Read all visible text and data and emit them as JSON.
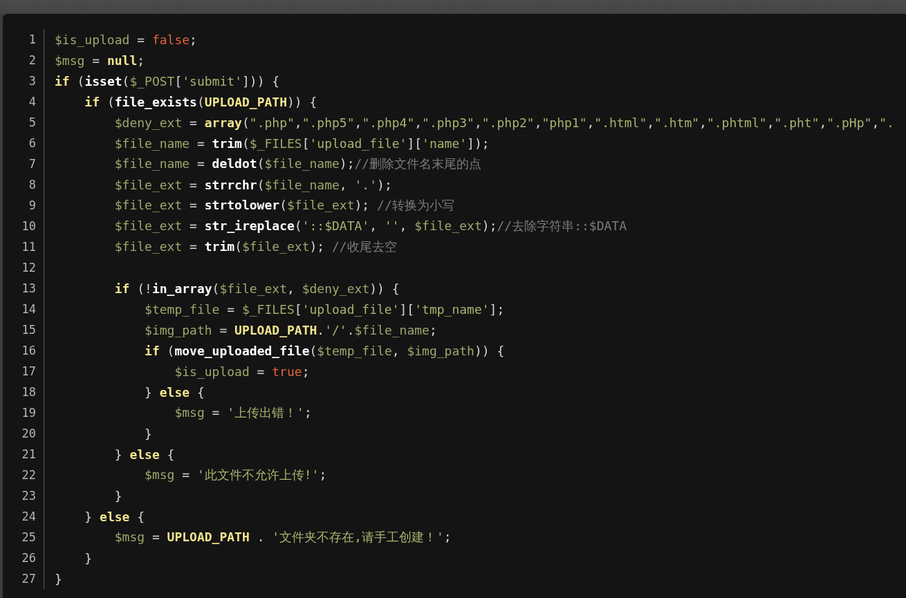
{
  "code": {
    "lines": [
      {
        "number": "1",
        "tokens": [
          {
            "kind": "var",
            "text": "$is_upload"
          },
          {
            "kind": "plain",
            "text": " = "
          },
          {
            "kind": "lit",
            "text": "false"
          },
          {
            "kind": "plain",
            "text": ";"
          }
        ]
      },
      {
        "number": "2",
        "tokens": [
          {
            "kind": "var",
            "text": "$msg"
          },
          {
            "kind": "plain",
            "text": " = "
          },
          {
            "kind": "kw",
            "text": "null"
          },
          {
            "kind": "plain",
            "text": ";"
          }
        ]
      },
      {
        "number": "3",
        "tokens": [
          {
            "kind": "kw",
            "text": "if"
          },
          {
            "kind": "plain",
            "text": " ("
          },
          {
            "kind": "fn",
            "text": "isset"
          },
          {
            "kind": "plain",
            "text": "("
          },
          {
            "kind": "var",
            "text": "$_POST"
          },
          {
            "kind": "plain",
            "text": "["
          },
          {
            "kind": "str",
            "text": "'submit'"
          },
          {
            "kind": "plain",
            "text": "])) {"
          }
        ]
      },
      {
        "number": "4",
        "tokens": [
          {
            "kind": "kw",
            "text": "    if"
          },
          {
            "kind": "plain",
            "text": " ("
          },
          {
            "kind": "fn",
            "text": "file_exists"
          },
          {
            "kind": "plain",
            "text": "("
          },
          {
            "kind": "kw",
            "text": "UPLOAD_PATH"
          },
          {
            "kind": "plain",
            "text": ")) {"
          }
        ]
      },
      {
        "number": "5",
        "tokens": [
          {
            "kind": "var",
            "text": "        $deny_ext"
          },
          {
            "kind": "plain",
            "text": " = "
          },
          {
            "kind": "kw",
            "text": "array"
          },
          {
            "kind": "plain",
            "text": "("
          },
          {
            "kind": "str",
            "text": "\".php\""
          },
          {
            "kind": "plain",
            "text": ","
          },
          {
            "kind": "str",
            "text": "\".php5\""
          },
          {
            "kind": "plain",
            "text": ","
          },
          {
            "kind": "str",
            "text": "\".php4\""
          },
          {
            "kind": "plain",
            "text": ","
          },
          {
            "kind": "str",
            "text": "\".php3\""
          },
          {
            "kind": "plain",
            "text": ","
          },
          {
            "kind": "str",
            "text": "\".php2\""
          },
          {
            "kind": "plain",
            "text": ","
          },
          {
            "kind": "str",
            "text": "\"php1\""
          },
          {
            "kind": "plain",
            "text": ","
          },
          {
            "kind": "str",
            "text": "\".html\""
          },
          {
            "kind": "plain",
            "text": ","
          },
          {
            "kind": "str",
            "text": "\".htm\""
          },
          {
            "kind": "plain",
            "text": ","
          },
          {
            "kind": "str",
            "text": "\".phtml\""
          },
          {
            "kind": "plain",
            "text": ","
          },
          {
            "kind": "str",
            "text": "\".pht\""
          },
          {
            "kind": "plain",
            "text": ","
          },
          {
            "kind": "str",
            "text": "\".pHp\""
          },
          {
            "kind": "plain",
            "text": ","
          },
          {
            "kind": "str",
            "text": "\"."
          }
        ]
      },
      {
        "number": "6",
        "tokens": [
          {
            "kind": "var",
            "text": "        $file_name"
          },
          {
            "kind": "plain",
            "text": " = "
          },
          {
            "kind": "fn",
            "text": "trim"
          },
          {
            "kind": "plain",
            "text": "("
          },
          {
            "kind": "var",
            "text": "$_FILES"
          },
          {
            "kind": "plain",
            "text": "["
          },
          {
            "kind": "str",
            "text": "'upload_file'"
          },
          {
            "kind": "plain",
            "text": "]["
          },
          {
            "kind": "str",
            "text": "'name'"
          },
          {
            "kind": "plain",
            "text": "]);"
          }
        ]
      },
      {
        "number": "7",
        "tokens": [
          {
            "kind": "var",
            "text": "        $file_name"
          },
          {
            "kind": "plain",
            "text": " = "
          },
          {
            "kind": "fn",
            "text": "deldot"
          },
          {
            "kind": "plain",
            "text": "("
          },
          {
            "kind": "var",
            "text": "$file_name"
          },
          {
            "kind": "plain",
            "text": ");"
          },
          {
            "kind": "cmt",
            "text": "//删除文件名末尾的点"
          }
        ]
      },
      {
        "number": "8",
        "tokens": [
          {
            "kind": "var",
            "text": "        $file_ext"
          },
          {
            "kind": "plain",
            "text": " = "
          },
          {
            "kind": "fn",
            "text": "strrchr"
          },
          {
            "kind": "plain",
            "text": "("
          },
          {
            "kind": "var",
            "text": "$file_name"
          },
          {
            "kind": "plain",
            "text": ", "
          },
          {
            "kind": "str",
            "text": "'.'"
          },
          {
            "kind": "plain",
            "text": ");"
          }
        ]
      },
      {
        "number": "9",
        "tokens": [
          {
            "kind": "var",
            "text": "        $file_ext"
          },
          {
            "kind": "plain",
            "text": " = "
          },
          {
            "kind": "fn",
            "text": "strtolower"
          },
          {
            "kind": "plain",
            "text": "("
          },
          {
            "kind": "var",
            "text": "$file_ext"
          },
          {
            "kind": "plain",
            "text": "); "
          },
          {
            "kind": "cmt",
            "text": "//转换为小写"
          }
        ]
      },
      {
        "number": "10",
        "tokens": [
          {
            "kind": "var",
            "text": "        $file_ext"
          },
          {
            "kind": "plain",
            "text": " = "
          },
          {
            "kind": "fn",
            "text": "str_ireplace"
          },
          {
            "kind": "plain",
            "text": "("
          },
          {
            "kind": "str",
            "text": "'::$DATA'"
          },
          {
            "kind": "plain",
            "text": ", "
          },
          {
            "kind": "str",
            "text": "''"
          },
          {
            "kind": "plain",
            "text": ", "
          },
          {
            "kind": "var",
            "text": "$file_ext"
          },
          {
            "kind": "plain",
            "text": ");"
          },
          {
            "kind": "cmt",
            "text": "//去除字符串::$DATA"
          }
        ]
      },
      {
        "number": "11",
        "tokens": [
          {
            "kind": "var",
            "text": "        $file_ext"
          },
          {
            "kind": "plain",
            "text": " = "
          },
          {
            "kind": "fn",
            "text": "trim"
          },
          {
            "kind": "plain",
            "text": "("
          },
          {
            "kind": "var",
            "text": "$file_ext"
          },
          {
            "kind": "plain",
            "text": "); "
          },
          {
            "kind": "cmt",
            "text": "//收尾去空"
          }
        ]
      },
      {
        "number": "12"
      },
      {
        "number": "13",
        "tokens": [
          {
            "kind": "kw",
            "text": "        if"
          },
          {
            "kind": "plain",
            "text": " (!"
          },
          {
            "kind": "fn",
            "text": "in_array"
          },
          {
            "kind": "plain",
            "text": "("
          },
          {
            "kind": "var",
            "text": "$file_ext"
          },
          {
            "kind": "plain",
            "text": ", "
          },
          {
            "kind": "var",
            "text": "$deny_ext"
          },
          {
            "kind": "plain",
            "text": ")) {"
          }
        ]
      },
      {
        "number": "14",
        "tokens": [
          {
            "kind": "var",
            "text": "            $temp_file"
          },
          {
            "kind": "plain",
            "text": " = "
          },
          {
            "kind": "var",
            "text": "$_FILES"
          },
          {
            "kind": "plain",
            "text": "["
          },
          {
            "kind": "str",
            "text": "'upload_file'"
          },
          {
            "kind": "plain",
            "text": "]["
          },
          {
            "kind": "str",
            "text": "'tmp_name'"
          },
          {
            "kind": "plain",
            "text": "];"
          }
        ]
      },
      {
        "number": "15",
        "tokens": [
          {
            "kind": "var",
            "text": "            $img_path"
          },
          {
            "kind": "plain",
            "text": " = "
          },
          {
            "kind": "kw",
            "text": "UPLOAD_PATH"
          },
          {
            "kind": "plain",
            "text": "."
          },
          {
            "kind": "str",
            "text": "'/'"
          },
          {
            "kind": "plain",
            "text": "."
          },
          {
            "kind": "var",
            "text": "$file_name"
          },
          {
            "kind": "plain",
            "text": ";"
          }
        ]
      },
      {
        "number": "16",
        "tokens": [
          {
            "kind": "kw",
            "text": "            if"
          },
          {
            "kind": "plain",
            "text": " ("
          },
          {
            "kind": "fn",
            "text": "move_uploaded_file"
          },
          {
            "kind": "plain",
            "text": "("
          },
          {
            "kind": "var",
            "text": "$temp_file"
          },
          {
            "kind": "plain",
            "text": ", "
          },
          {
            "kind": "var",
            "text": "$img_path"
          },
          {
            "kind": "plain",
            "text": ")) {"
          }
        ]
      },
      {
        "number": "17",
        "tokens": [
          {
            "kind": "var",
            "text": "                $is_upload"
          },
          {
            "kind": "plain",
            "text": " = "
          },
          {
            "kind": "lit",
            "text": "true"
          },
          {
            "kind": "plain",
            "text": ";"
          }
        ]
      },
      {
        "number": "18",
        "tokens": [
          {
            "kind": "plain",
            "text": "            } "
          },
          {
            "kind": "kw",
            "text": "else"
          },
          {
            "kind": "plain",
            "text": " {"
          }
        ]
      },
      {
        "number": "19",
        "tokens": [
          {
            "kind": "var",
            "text": "                $msg"
          },
          {
            "kind": "plain",
            "text": " = "
          },
          {
            "kind": "str",
            "text": "'上传出错！'"
          },
          {
            "kind": "plain",
            "text": ";"
          }
        ]
      },
      {
        "number": "20",
        "tokens": [
          {
            "kind": "plain",
            "text": "            }"
          }
        ]
      },
      {
        "number": "21",
        "tokens": [
          {
            "kind": "plain",
            "text": "        } "
          },
          {
            "kind": "kw",
            "text": "else"
          },
          {
            "kind": "plain",
            "text": " {"
          }
        ]
      },
      {
        "number": "22",
        "tokens": [
          {
            "kind": "var",
            "text": "            $msg"
          },
          {
            "kind": "plain",
            "text": " = "
          },
          {
            "kind": "str",
            "text": "'此文件不允许上传!'"
          },
          {
            "kind": "plain",
            "text": ";"
          }
        ]
      },
      {
        "number": "23",
        "tokens": [
          {
            "kind": "plain",
            "text": "        }"
          }
        ]
      },
      {
        "number": "24",
        "tokens": [
          {
            "kind": "plain",
            "text": "    } "
          },
          {
            "kind": "kw",
            "text": "else"
          },
          {
            "kind": "plain",
            "text": " {"
          }
        ]
      },
      {
        "number": "25",
        "tokens": [
          {
            "kind": "var",
            "text": "        $msg"
          },
          {
            "kind": "plain",
            "text": " = "
          },
          {
            "kind": "kw",
            "text": "UPLOAD_PATH"
          },
          {
            "kind": "plain",
            "text": " . "
          },
          {
            "kind": "str",
            "text": "'文件夹不存在,请手工创建！'"
          },
          {
            "kind": "plain",
            "text": ";"
          }
        ]
      },
      {
        "number": "26",
        "tokens": [
          {
            "kind": "plain",
            "text": "    }"
          }
        ]
      },
      {
        "number": "27",
        "tokens": [
          {
            "kind": "plain",
            "text": "}"
          }
        ]
      }
    ]
  }
}
